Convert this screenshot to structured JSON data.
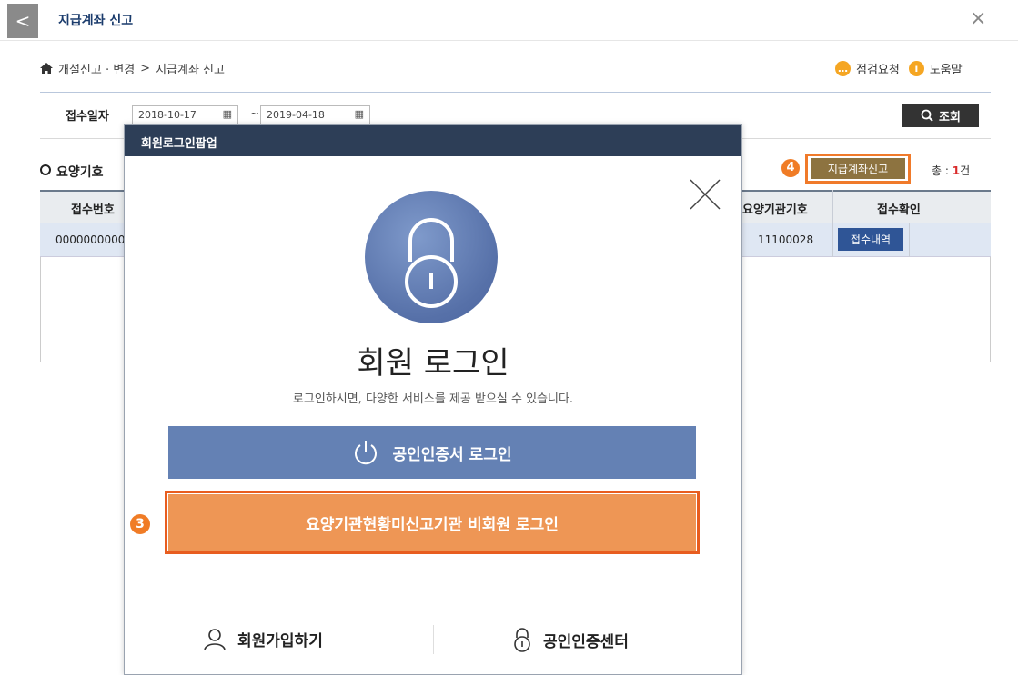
{
  "window": {
    "title": "지급계좌 신고",
    "back_glyph": "<",
    "close_glyph": "×"
  },
  "breadcrumb": {
    "home_icon": "home-icon",
    "path_1": "개설신고 · 변경",
    "separator": ">",
    "path_2": "지급계좌 신고"
  },
  "help": {
    "inspect_label": "점검요청",
    "help_label": "도움말",
    "inspect_color": "#f5a623",
    "help_color": "#f5a623"
  },
  "search": {
    "label": "접수일자",
    "date_from": "2018-10-17",
    "date_to": "2019-04-18",
    "tilde": "~",
    "button_label": "조회"
  },
  "section": {
    "title": "요양기호",
    "badge": "4",
    "report_button": "지급계좌신고",
    "total_label": "총 :",
    "total_count": "1",
    "total_unit": "건"
  },
  "table": {
    "headers": [
      "접수번호",
      "요양기관기호",
      "접수확인"
    ],
    "rows": [
      {
        "receipt_no": "0000000000",
        "institution_code": "11100028",
        "action": "접수내역"
      }
    ]
  },
  "popup": {
    "header_title": "회원로그인팝업",
    "title": "회원 로그인",
    "subtitle": "로그인하시면, 다양한 서비스를 제공 받으실 수 있습니다.",
    "cert_login": "공인인증서 로그인",
    "nonmember_login": "요양기관현황미신고기관 비회원 로그인",
    "nonmember_badge": "3",
    "join": "회원가입하기",
    "cert_center": "공인인증센터"
  },
  "colors": {
    "accent_orange": "#f07c26",
    "popup_header": "#2d3e57",
    "cert_button": "#6481b4",
    "nonmember_button": "#ee9655"
  }
}
